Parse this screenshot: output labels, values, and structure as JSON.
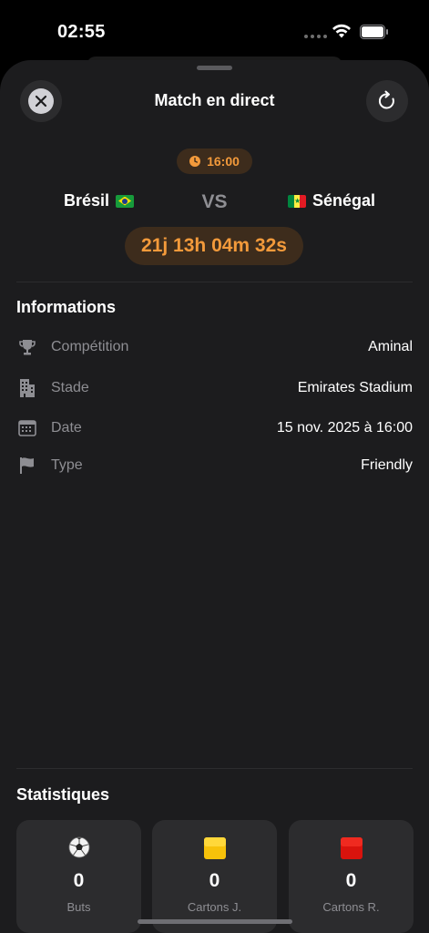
{
  "status_bar": {
    "time": "02:55"
  },
  "header": {
    "title": "Match en direct"
  },
  "match": {
    "kickoff_time": "16:00",
    "home_team": "Brésil",
    "away_team": "Sénégal",
    "vs_label": "VS",
    "countdown": "21j 13h 04m 32s"
  },
  "info": {
    "title": "Informations",
    "rows": [
      {
        "icon": "trophy-icon",
        "label": "Compétition",
        "value": "Aminal"
      },
      {
        "icon": "building-icon",
        "label": "Stade",
        "value": "Emirates Stadium"
      },
      {
        "icon": "calendar-icon",
        "label": "Date",
        "value": "15 nov. 2025 à 16:00"
      },
      {
        "icon": "flag-icon",
        "label": "Type",
        "value": "Friendly"
      }
    ]
  },
  "stats": {
    "title": "Statistiques",
    "cards": [
      {
        "icon": "soccer-ball-icon",
        "value": "0",
        "label": "Buts"
      },
      {
        "icon": "yellow-card-icon",
        "value": "0",
        "label": "Cartons J."
      },
      {
        "icon": "red-card-icon",
        "value": "0",
        "label": "Cartons R."
      }
    ]
  },
  "colors": {
    "accent": "#f39a3b",
    "accent_bg": "#3d2c1c",
    "sheet_bg": "#1c1c1e",
    "card_bg": "#2c2c2e",
    "secondary_text": "#8e8e93"
  }
}
